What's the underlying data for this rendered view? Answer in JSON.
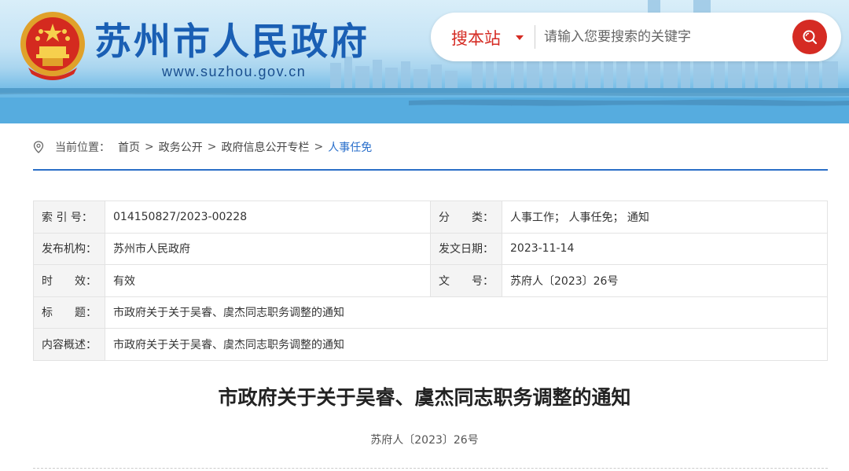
{
  "header": {
    "site_name": "苏州市人民政府",
    "site_url": "www.suzhou.gov.cn",
    "search": {
      "scope_label": "搜本站",
      "placeholder": "请输入您要搜索的关键字",
      "value": ""
    },
    "accent_color": "#d52b23",
    "brand_color": "#1a5fb4"
  },
  "breadcrumb": {
    "prefix": "当前位置：",
    "items": [
      "首页",
      "政务公开",
      "政府信息公开专栏"
    ],
    "current": "人事任免",
    "separator": ">"
  },
  "meta": {
    "index_label": "索 引 号：",
    "index_value": "014150827/2023-00228",
    "category_label": "分　　类：",
    "category_value": "人事工作；  人事任免；  通知",
    "publisher_label": "发布机构：",
    "publisher_value": "苏州市人民政府",
    "date_label": "发文日期：",
    "date_value": "2023-11-14",
    "validity_label": "时　　效：",
    "validity_value": "有效",
    "docno_label": "文　　号：",
    "docno_value": "苏府人〔2023〕26号",
    "title_label": "标　　题：",
    "title_value": "市政府关于关于吴睿、虞杰同志职务调整的通知",
    "summary_label": "内容概述：",
    "summary_value": "市政府关于关于吴睿、虞杰同志职务调整的通知"
  },
  "article": {
    "title": "市政府关于关于吴睿、虞杰同志职务调整的通知",
    "doc_number": "苏府人〔2023〕26号"
  }
}
